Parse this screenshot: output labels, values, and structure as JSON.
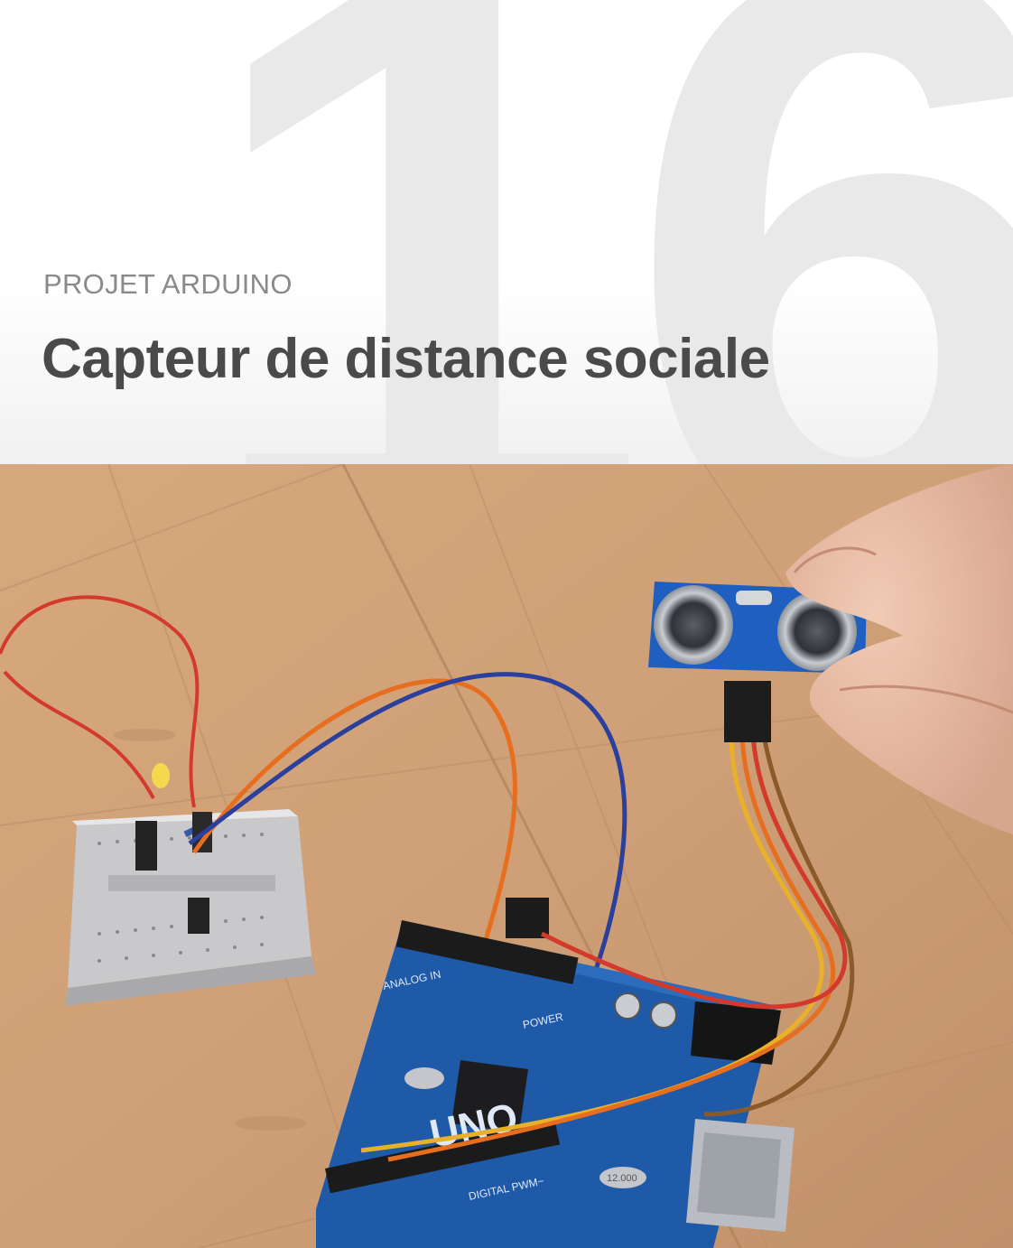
{
  "header": {
    "project_number": "16",
    "eyebrow": "PROJET ARDUINO",
    "title": "Capteur de distance sociale"
  },
  "photo": {
    "board_label_uno": "UNO",
    "board_label_power": "POWER",
    "board_label_analog": "ANALOG IN",
    "board_label_digital": "DIGITAL PWM~",
    "crystal_label": "12.000"
  }
}
